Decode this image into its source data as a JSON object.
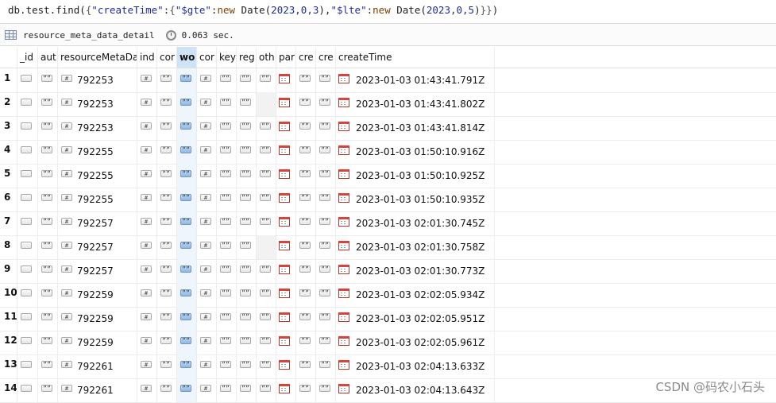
{
  "query": {
    "parts": [
      {
        "t": "db.test.find(",
        "c": "plain"
      },
      {
        "t": "{",
        "c": "br"
      },
      {
        "t": "\"createTime\"",
        "c": "str"
      },
      {
        "t": ":",
        "c": "plain"
      },
      {
        "t": "{",
        "c": "br"
      },
      {
        "t": "\"$gte\"",
        "c": "str"
      },
      {
        "t": ":",
        "c": "plain"
      },
      {
        "t": "new",
        "c": "kw"
      },
      {
        "t": " Date(",
        "c": "plain"
      },
      {
        "t": "2023,0,3",
        "c": "num"
      },
      {
        "t": "),",
        "c": "plain"
      },
      {
        "t": "\"$lte\"",
        "c": "str"
      },
      {
        "t": ":",
        "c": "plain"
      },
      {
        "t": "new",
        "c": "kw"
      },
      {
        "t": " Date(",
        "c": "plain"
      },
      {
        "t": "2023,0,5",
        "c": "num"
      },
      {
        "t": ")",
        "c": "plain"
      },
      {
        "t": "}}",
        "c": "br"
      },
      {
        "t": ")",
        "c": "plain"
      }
    ]
  },
  "info": {
    "collection": "resource_meta_data_detail",
    "elapsed": "0.063 sec."
  },
  "columns": [
    {
      "key": "rownum",
      "label": ""
    },
    {
      "key": "_id",
      "label": "_id"
    },
    {
      "key": "aut",
      "label": "aut"
    },
    {
      "key": "resourceMetaDa",
      "label": "resourceMetaDa"
    },
    {
      "key": "ind",
      "label": "ind"
    },
    {
      "key": "cor1",
      "label": "cor"
    },
    {
      "key": "wo",
      "label": "wo",
      "selected": true
    },
    {
      "key": "cor2",
      "label": "cor"
    },
    {
      "key": "key",
      "label": "key"
    },
    {
      "key": "reg",
      "label": "reg"
    },
    {
      "key": "oth",
      "label": "oth"
    },
    {
      "key": "par",
      "label": "par"
    },
    {
      "key": "cre1",
      "label": "cre"
    },
    {
      "key": "cre2",
      "label": "cre"
    },
    {
      "key": "createTime",
      "label": "createTime"
    }
  ],
  "rows": [
    {
      "n": "1",
      "meta": "792253",
      "time": "2023-01-03 01:43:41.791Z",
      "oth": true
    },
    {
      "n": "2",
      "meta": "792253",
      "time": "2023-01-03 01:43:41.802Z",
      "oth": false
    },
    {
      "n": "3",
      "meta": "792253",
      "time": "2023-01-03 01:43:41.814Z",
      "oth": true
    },
    {
      "n": "4",
      "meta": "792255",
      "time": "2023-01-03 01:50:10.916Z",
      "oth": true
    },
    {
      "n": "5",
      "meta": "792255",
      "time": "2023-01-03 01:50:10.925Z",
      "oth": true
    },
    {
      "n": "6",
      "meta": "792255",
      "time": "2023-01-03 01:50:10.935Z",
      "oth": true
    },
    {
      "n": "7",
      "meta": "792257",
      "time": "2023-01-03 02:01:30.745Z",
      "oth": true
    },
    {
      "n": "8",
      "meta": "792257",
      "time": "2023-01-03 02:01:30.758Z",
      "oth": false
    },
    {
      "n": "9",
      "meta": "792257",
      "time": "2023-01-03 02:01:30.773Z",
      "oth": true
    },
    {
      "n": "10",
      "meta": "792259",
      "time": "2023-01-03 02:02:05.934Z",
      "oth": true
    },
    {
      "n": "11",
      "meta": "792259",
      "time": "2023-01-03 02:02:05.951Z",
      "oth": true
    },
    {
      "n": "12",
      "meta": "792259",
      "time": "2023-01-03 02:02:05.961Z",
      "oth": true
    },
    {
      "n": "13",
      "meta": "792261",
      "time": "2023-01-03 02:04:13.633Z",
      "oth": true
    },
    {
      "n": "14",
      "meta": "792261",
      "time": "2023-01-03 02:04:13.643Z",
      "oth": true
    }
  ],
  "watermark": "CSDN @码农小石头",
  "colors": {
    "selected_header": "#cfe3f7",
    "selected_chip": "#8fb8e4",
    "calendar_red": "#d9443a"
  }
}
